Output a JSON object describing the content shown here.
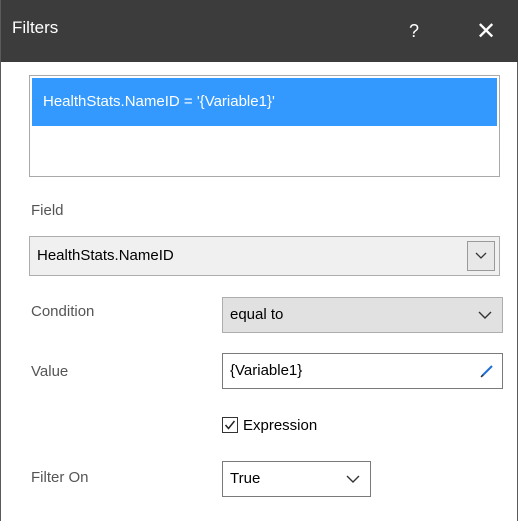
{
  "window": {
    "title": "Filters",
    "help_label": "?",
    "close_label": "✕"
  },
  "filter_list": {
    "items": [
      {
        "expression": "HealthStats.NameID = '{Variable1}'"
      }
    ]
  },
  "field": {
    "label": "Field",
    "value": "HealthStats.NameID"
  },
  "condition": {
    "label": "Condition",
    "value": "equal to"
  },
  "value": {
    "label": "Value",
    "value": "{Variable1}"
  },
  "expression": {
    "label": "Expression",
    "checked": true
  },
  "filter_on": {
    "label": "Filter On",
    "value": "True"
  },
  "colors": {
    "titlebar": "#3c3c3c",
    "selection": "#3399ff",
    "pencil": "#1e6fd9"
  }
}
